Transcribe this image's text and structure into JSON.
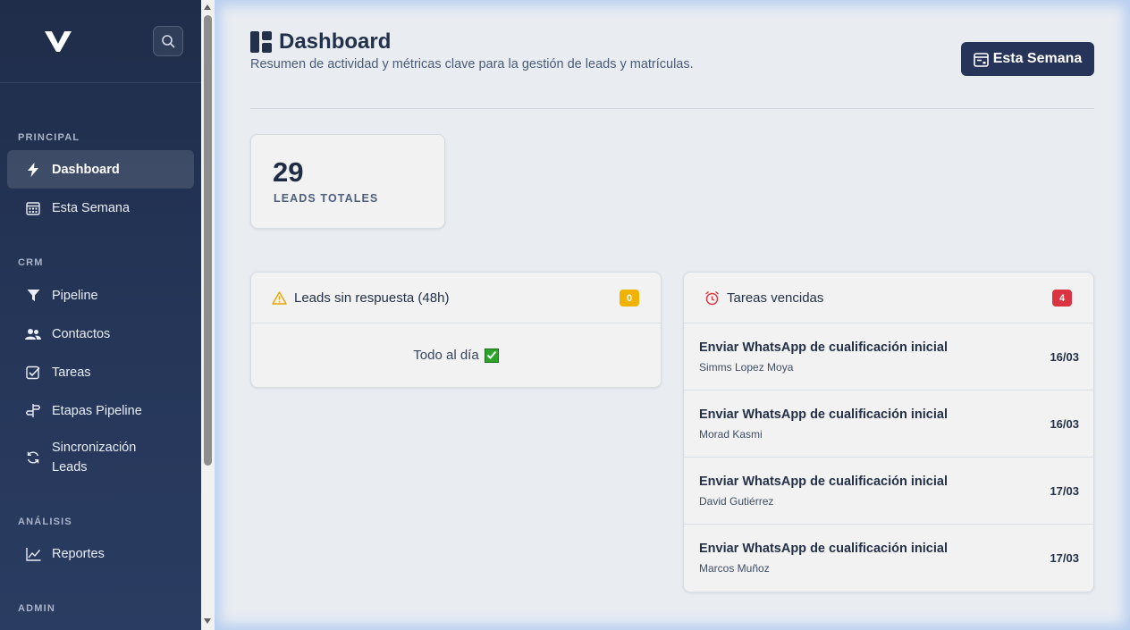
{
  "sidebar": {
    "sections": {
      "principal": "PRINCIPAL",
      "crm": "CRM",
      "analisis": "ANÁLISIS",
      "admin": "ADMIN"
    },
    "items": {
      "dashboard": "Dashboard",
      "esta_semana": "Esta Semana",
      "pipeline": "Pipeline",
      "contactos": "Contactos",
      "tareas": "Tareas",
      "etapas": "Etapas Pipeline",
      "sincronizacion": "Sincronización Leads",
      "reportes": "Reportes"
    },
    "active": "dashboard"
  },
  "header": {
    "title": "Dashboard",
    "subtitle": "Resumen de actividad y métricas clave para la gestión de leads y matrículas.",
    "week_button": "Esta Semana"
  },
  "stats": {
    "leads_total_value": "29",
    "leads_total_label": "LEADS TOTALES"
  },
  "no_response_panel": {
    "title": "Leads sin respuesta (48h)",
    "badge": "0",
    "empty_message": "Todo al día"
  },
  "overdue_panel": {
    "title": "Tareas vencidas",
    "badge": "4",
    "tasks": [
      {
        "title": "Enviar WhatsApp de cualificación inicial",
        "contact": "Simms Lopez Moya",
        "date": "16/03"
      },
      {
        "title": "Enviar WhatsApp de cualificación inicial",
        "contact": "Morad Kasmi",
        "date": "16/03"
      },
      {
        "title": "Enviar WhatsApp de cualificación inicial",
        "contact": "David Gutiérrez",
        "date": "17/03"
      },
      {
        "title": "Enviar WhatsApp de cualificación inicial",
        "contact": "Marcos Muñoz",
        "date": "17/03"
      }
    ]
  },
  "colors": {
    "sidebar_bg": "#1f2d4a",
    "primary_button": "#27345a",
    "badge_warning": "#f0b400",
    "badge_danger": "#d9343f",
    "check_green": "#2aa52a"
  }
}
